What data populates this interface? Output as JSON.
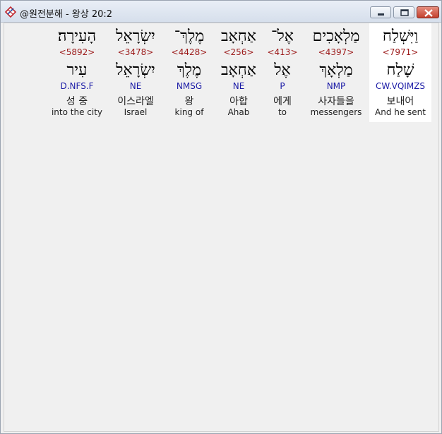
{
  "window": {
    "title": "@원전분해 - 왕상 20:2"
  },
  "words": [
    {
      "hebrew": "וַיִּשְׁלַח",
      "strong": "<7971>",
      "root": "שָׁלַח",
      "parse": "CW.VQIMZS",
      "korean": "보내어",
      "english": "And he sent",
      "selected": true
    },
    {
      "hebrew": "מַלְאָכִים",
      "strong": "<4397>",
      "root": "מַלְאָךְ",
      "parse": "NMP",
      "korean": "사자들을",
      "english": "messengers",
      "selected": false
    },
    {
      "hebrew": "אֶל־",
      "strong": "<413>",
      "root": "אֶל",
      "parse": "P",
      "korean": "에게",
      "english": "to",
      "selected": false
    },
    {
      "hebrew": "אַחְאָב",
      "strong": "<256>",
      "root": "אַחְאָב",
      "parse": "NE",
      "korean": "아합",
      "english": "Ahab",
      "selected": false
    },
    {
      "hebrew": "מֶלֶךְ־",
      "strong": "<4428>",
      "root": "מֶלֶךְ",
      "parse": "NMSG",
      "korean": "왕",
      "english": "king of",
      "selected": false
    },
    {
      "hebrew": "יִשְׂרָאֵל",
      "strong": "<3478>",
      "root": "יִשְׂרָאֵל",
      "parse": "NE",
      "korean": "이스라엘",
      "english": "Israel",
      "selected": false
    },
    {
      "hebrew": "הָעִירָה׃",
      "strong": "<5892>",
      "root": "עִיר",
      "parse": "D.NFS.F",
      "korean": "성 중",
      "english": "into the city",
      "selected": false
    }
  ]
}
